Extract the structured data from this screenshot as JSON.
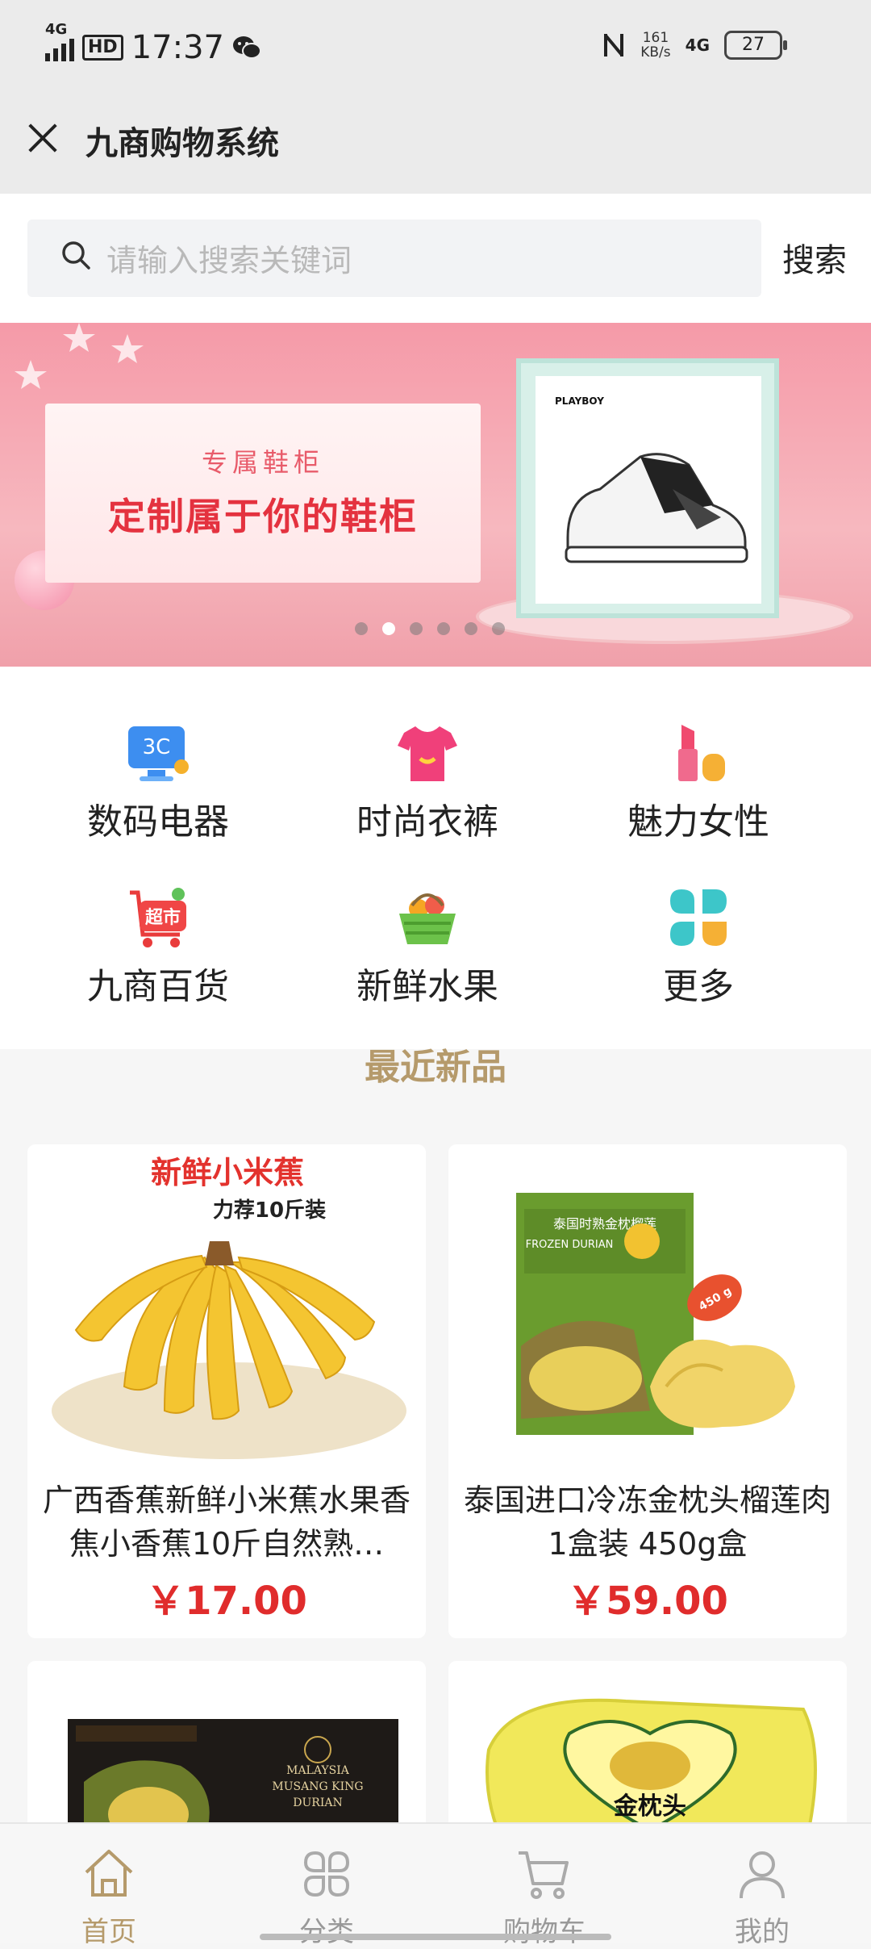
{
  "status_bar": {
    "network": "4G",
    "hd": "HD",
    "time": "17:37",
    "speed_value": "161",
    "speed_unit": "KB/s",
    "network_right": "4G",
    "battery": "27",
    "icons": [
      "signal-icon",
      "hd-icon",
      "wechat-icon",
      "nfc-icon",
      "battery-icon"
    ]
  },
  "header": {
    "title": "九商购物系统"
  },
  "search": {
    "placeholder": "请输入搜索关键词",
    "button_label": "搜索"
  },
  "banner": {
    "subtitle": "专属鞋柜",
    "headline": "定制属于你的鞋柜",
    "brand": "PLAYBOY",
    "slide_count": 6,
    "active_slide": 2
  },
  "categories": [
    {
      "label": "数码电器",
      "icon": "3c-monitor-icon",
      "icon_text": "3C"
    },
    {
      "label": "时尚衣裤",
      "icon": "tshirt-icon"
    },
    {
      "label": "魅力女性",
      "icon": "lipstick-icon"
    },
    {
      "label": "九商百货",
      "icon": "supermarket-cart-icon",
      "icon_text": "超市"
    },
    {
      "label": "新鲜水果",
      "icon": "fruit-basket-icon"
    },
    {
      "label": "更多",
      "icon": "more-grid-icon"
    }
  ],
  "section": {
    "title": "最近新品"
  },
  "products": [
    {
      "name": "广西香蕉新鲜小米蕉水果香焦小香蕉10斤自然熟…",
      "price": "￥17.00",
      "image_text_1": "新鲜小米蕉",
      "image_text_2": "力荐10斤装"
    },
    {
      "name": "泰国进口冷冻金枕头榴莲肉 1盒装 450g盒",
      "price": "￥59.00",
      "image_text_1": "泰国时熟金枕榴莲",
      "image_text_2": "FROZEN DURIAN",
      "image_text_3": "450 g"
    },
    {
      "name": "",
      "price": "",
      "image_text_1": "MALAYSIA",
      "image_text_2": "MUSANG KING",
      "image_text_3": "DURIAN"
    },
    {
      "name": "",
      "price": "",
      "image_text_1": "金枕头"
    }
  ],
  "bottom_nav": [
    {
      "label": "首页",
      "icon": "home-icon",
      "active": true
    },
    {
      "label": "分类",
      "icon": "category-icon",
      "active": false
    },
    {
      "label": "购物车",
      "icon": "cart-icon",
      "active": false
    },
    {
      "label": "我的",
      "icon": "user-icon",
      "active": false
    }
  ],
  "colors": {
    "accent": "#b59a6b",
    "price": "#e02c2c",
    "banner_pink": "#f59aa8"
  }
}
